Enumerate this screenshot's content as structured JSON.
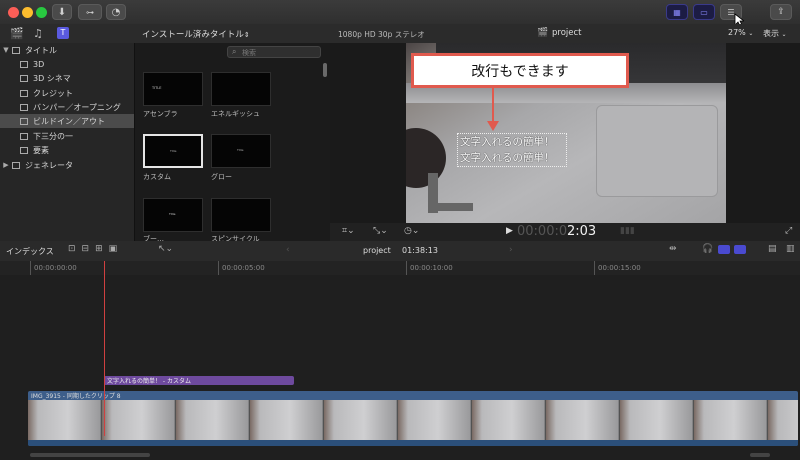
{
  "window": {
    "toolbar_icons": [
      "import-icon",
      "keywords-icon",
      "background-tasks-icon"
    ],
    "view_icons": [
      "browser-view-icon",
      "timeline-view-icon",
      "inspector-view-icon"
    ],
    "share_icon": "share-icon"
  },
  "libraries": {
    "items": [
      {
        "label": "タイトル",
        "expanded": true
      },
      {
        "label": "3D"
      },
      {
        "label": "3D シネマ"
      },
      {
        "label": "クレジット"
      },
      {
        "label": "バンパー／オープニング"
      },
      {
        "label": "ビルドイン／アウト",
        "selected": true
      },
      {
        "label": "下三分の一"
      },
      {
        "label": "要素"
      },
      {
        "label": "ジェネレータ",
        "expanded": false
      }
    ]
  },
  "browser": {
    "header_title": "インストール済みタイトル",
    "search_placeholder": "検索",
    "thumbs": [
      {
        "label": "アセンブラ",
        "inner": "TITLE"
      },
      {
        "label": "エネルギッシュ",
        "inner": ""
      },
      {
        "label": "カスタム",
        "inner": "Title",
        "selected": true
      },
      {
        "label": "グロー",
        "inner": "Title"
      },
      {
        "label": "ブー…",
        "inner": "Title"
      },
      {
        "label": "スピンサイクル",
        "inner": ""
      }
    ]
  },
  "viewer": {
    "format": "1080p HD 30p ステレオ",
    "project_name": "project",
    "zoom": "27%",
    "view_menu": "表示",
    "callout_text": "改行もできます",
    "overlay_line1": "文字入れるの簡単！",
    "overlay_line2": "文字入れるの簡単！",
    "timecode_dim": "00:00:0",
    "timecode_bright": "2:03"
  },
  "timeline": {
    "index_label": "インデックス",
    "project_name": "project",
    "duration": "01:38:13",
    "ruler": [
      "00:00:00:00",
      "00:00:05:00",
      "00:00:10:00",
      "00:00:15:00"
    ],
    "title_clip": "文字入れるの簡単！ - カスタム",
    "video_clip": "IMG_3915 - 同期したクリップ 8"
  },
  "colors": {
    "accent": "#5a5ae0",
    "callout_border": "#e05a4e",
    "title_clip": "#6e4a9e",
    "video_clip": "#3d5e8a",
    "playhead": "#d04040"
  }
}
